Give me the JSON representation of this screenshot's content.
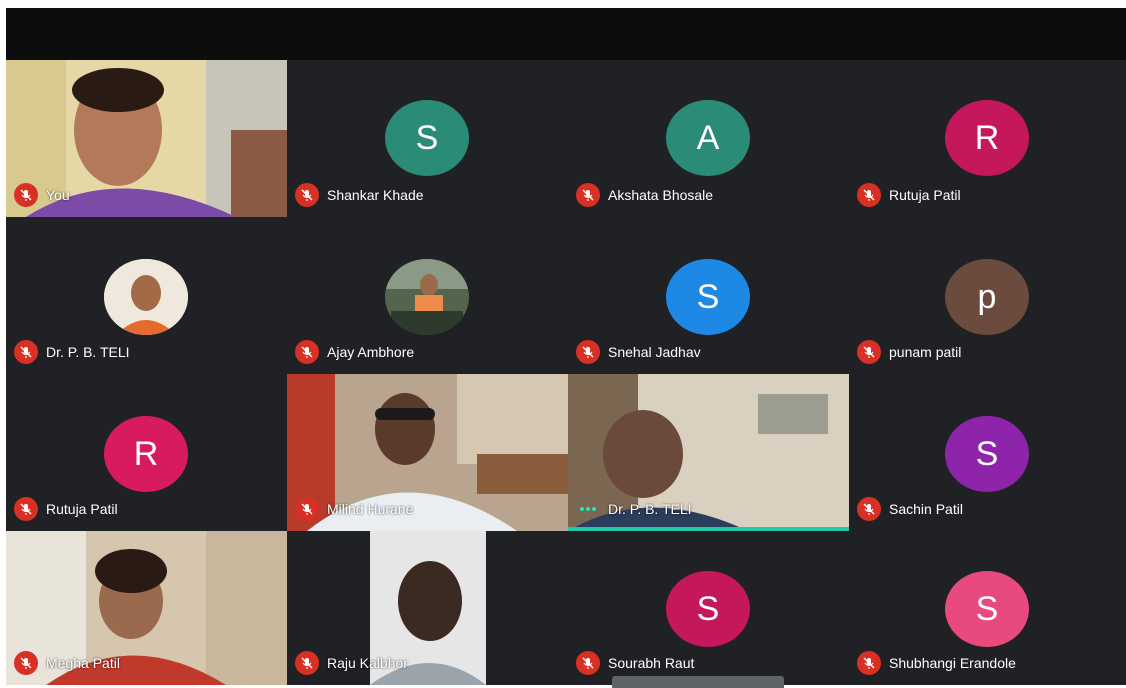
{
  "participants": [
    {
      "name": "You",
      "type": "video",
      "scene": "you"
    },
    {
      "name": "Shankar Khade",
      "type": "avatar",
      "initial": "S",
      "color": "#2a8b77"
    },
    {
      "name": "Akshata Bhosale",
      "type": "avatar",
      "initial": "A",
      "color": "#2a8b77"
    },
    {
      "name": "Rutuja Patil",
      "type": "avatar",
      "initial": "R",
      "color": "#c5175b"
    },
    {
      "name": "Dr. P. B. TELI",
      "type": "photo-avatar",
      "scene": "teli-avatar"
    },
    {
      "name": "Ajay Ambhore",
      "type": "photo-avatar",
      "scene": "ajay-avatar"
    },
    {
      "name": "Snehal Jadhav",
      "type": "avatar",
      "initial": "S",
      "color": "#1e88e5"
    },
    {
      "name": "punam patil",
      "type": "avatar",
      "initial": "p",
      "color": "#6b4b3e"
    },
    {
      "name": "Rutuja Patil",
      "type": "avatar",
      "initial": "R",
      "color": "#d81b60"
    },
    {
      "name": "Milind Hurane",
      "type": "video",
      "scene": "milind"
    },
    {
      "name": "Dr. P. B. TELI",
      "type": "video",
      "scene": "teli-video",
      "speaking": true
    },
    {
      "name": "Sachin Patil",
      "type": "avatar",
      "initial": "S",
      "color": "#8e24aa"
    },
    {
      "name": "Megha Patil",
      "type": "video",
      "scene": "megha"
    },
    {
      "name": "Raju Kalbhor",
      "type": "video",
      "scene": "raju"
    },
    {
      "name": "Sourabh Raut",
      "type": "avatar",
      "initial": "S",
      "color": "#c5175b"
    },
    {
      "name": "Shubhangi Erandole",
      "type": "avatar",
      "initial": "S",
      "color": "#e84a7d"
    }
  ],
  "colors": {
    "grid_background": "#202124",
    "mic_off": "#d93025",
    "speaking_accent": "#24c6a8",
    "top_bar": "#0d0d0d"
  },
  "icons": {
    "mic_off": "mic-off-icon",
    "speaking": "audio-level-icon"
  }
}
